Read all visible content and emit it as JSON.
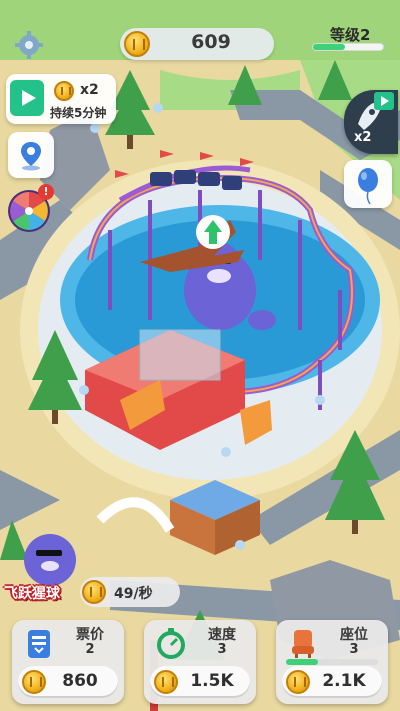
{
  "header": {
    "coins": "609",
    "level_label": "等级2",
    "level_progress": 0.45
  },
  "video_offer": {
    "multiplier": "x2",
    "duration": "持续5分钟"
  },
  "boost": {
    "multiplier": "x2"
  },
  "wheel": {
    "badge": "!"
  },
  "ride": {
    "name": "飞跃猩球",
    "income": "49/秒"
  },
  "upgrades": [
    {
      "label": "票价",
      "value": "2",
      "cost": "860",
      "icon": "ticket-icon",
      "progress": 0.0
    },
    {
      "label": "速度",
      "value": "3",
      "cost": "1.5K",
      "icon": "speed-icon",
      "progress": 0.0
    },
    {
      "label": "座位",
      "value": "3",
      "cost": "2.1K",
      "icon": "seat-icon",
      "progress": 0.35
    }
  ],
  "colors": {
    "accent_green": "#3fd07a",
    "video_green": "#23c28a",
    "coin_gold": "#f0b21b",
    "pool_blue": "#4fb6e8",
    "ride_red": "#e24a4a"
  }
}
